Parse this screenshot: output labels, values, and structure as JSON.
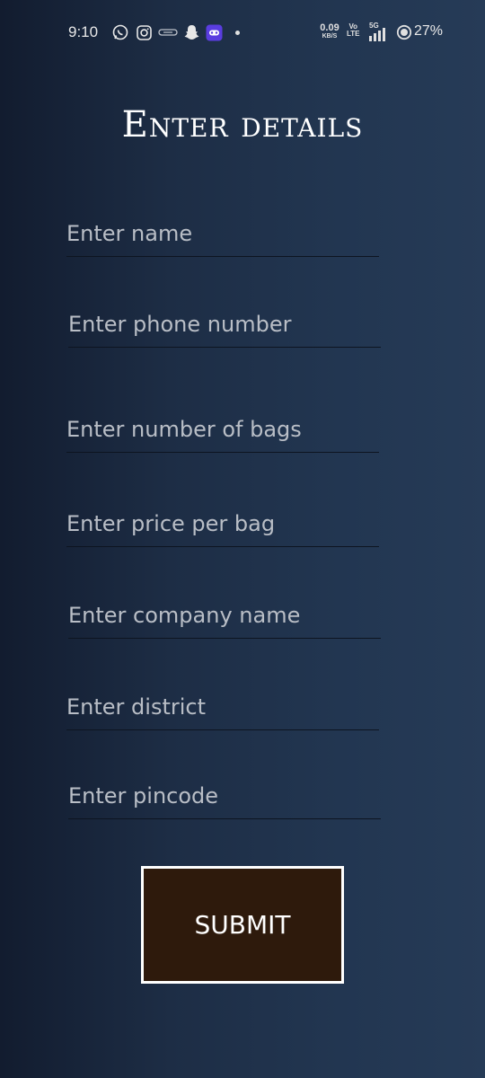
{
  "status_bar": {
    "time": "9:10",
    "net_speed_value": "0.09",
    "net_speed_unit": "KB/S",
    "volte_top": "Vo",
    "volte_bottom": "LTE",
    "signal_label": "5G",
    "battery_percent": "27%",
    "icons": [
      "whatsapp-icon",
      "instagram-icon",
      "link-icon",
      "snapchat-icon",
      "app-notification-icon",
      "dot-icon",
      "signal-icon",
      "battery-icon"
    ]
  },
  "form": {
    "title": "Enter details",
    "fields": {
      "name": {
        "placeholder": "Enter name",
        "value": ""
      },
      "phone": {
        "placeholder": "Enter phone number",
        "value": ""
      },
      "bags": {
        "placeholder": "Enter number of bags",
        "value": ""
      },
      "price": {
        "placeholder": "Enter price per bag",
        "value": ""
      },
      "company": {
        "placeholder": "Enter company name",
        "value": ""
      },
      "district": {
        "placeholder": "Enter district",
        "value": ""
      },
      "pincode": {
        "placeholder": "Enter pincode",
        "value": ""
      }
    },
    "submit_label": "SUBMIT"
  },
  "colors": {
    "background_left": "#121c2f",
    "background_right": "#263b57",
    "button_fill": "#2e1a0c",
    "button_border": "#ffffff",
    "placeholder": "#b9bec6",
    "underline": "#0d1420"
  }
}
